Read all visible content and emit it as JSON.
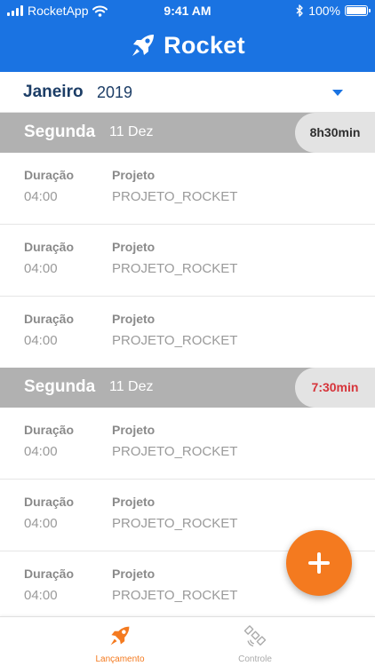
{
  "status_bar": {
    "carrier": "RocketApp",
    "time": "9:41 AM",
    "battery": "100%"
  },
  "header": {
    "title": "Rocket"
  },
  "month_selector": {
    "month": "Janeiro",
    "year": "2019"
  },
  "colors": {
    "primary": "#1a73e2",
    "accent": "#f47a1f",
    "warning": "#d6343a",
    "day_header": "#b1b1b1"
  },
  "days": [
    {
      "weekday": "Segunda",
      "date": "11 Dez",
      "total": "8h30min",
      "entries": [
        {
          "duration_label": "Duração",
          "duration": "04:00",
          "project_label": "Projeto",
          "project": "PROJETO_ROCKET"
        },
        {
          "duration_label": "Duração",
          "duration": "04:00",
          "project_label": "Projeto",
          "project": "PROJETO_ROCKET"
        },
        {
          "duration_label": "Duração",
          "duration": "04:00",
          "project_label": "Projeto",
          "project": "PROJETO_ROCKET"
        }
      ]
    },
    {
      "weekday": "Segunda",
      "date": "11 Dez",
      "total": "7:30min",
      "entries": [
        {
          "duration_label": "Duração",
          "duration": "04:00",
          "project_label": "Projeto",
          "project": "PROJETO_ROCKET"
        },
        {
          "duration_label": "Duração",
          "duration": "04:00",
          "project_label": "Projeto",
          "project": "PROJETO_ROCKET"
        },
        {
          "duration_label": "Duração",
          "duration": "04:00",
          "project_label": "Projeto",
          "project": "PROJETO_ROCKET"
        }
      ]
    }
  ],
  "fab": {
    "icon": "plus-icon"
  },
  "tabs": [
    {
      "label": "Lançamento",
      "icon": "rocket-icon"
    },
    {
      "label": "Controle",
      "icon": "satellite-icon"
    }
  ]
}
